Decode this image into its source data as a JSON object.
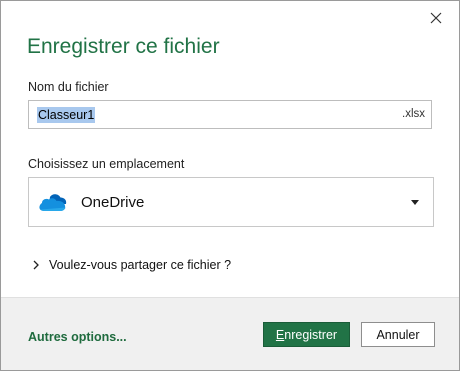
{
  "dialog": {
    "title": "Enregistrer ce fichier",
    "close_icon": "close-icon"
  },
  "filename": {
    "label": "Nom du fichier",
    "value": "Classeur1",
    "extension": ".xlsx"
  },
  "location": {
    "label": "Choisissez un emplacement",
    "selected": "OneDrive",
    "icon": "onedrive-cloud-icon",
    "dropdown_icon": "caret-down-icon"
  },
  "share": {
    "label": "Voulez-vous partager ce fichier ?",
    "icon": "chevron-right-icon"
  },
  "footer": {
    "more_options": "Autres options...",
    "save_first_letter": "E",
    "save_rest": "nregistrer",
    "cancel": "Annuler"
  },
  "colors": {
    "accent": "#217346",
    "selection": "#a8c8ee",
    "footer_bg": "#f0f0f0"
  }
}
